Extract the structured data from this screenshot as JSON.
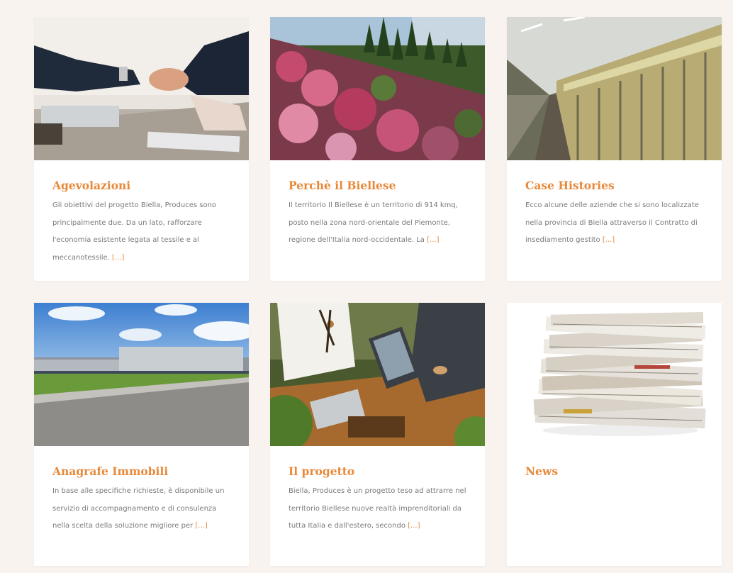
{
  "cards": [
    {
      "title": "Agevolazioni",
      "text": "Gli obiettivi del progetto Biella, Produces sono principalmente due. Da un lato, rafforzare l'economia esistente legata al tessile e al meccanotessile.",
      "more": "[...]",
      "image_icon": "handshake-image"
    },
    {
      "title": "Perchè il Biellese",
      "text": "Il territorio Il Biellese è un territorio di 914 kmq, posto nella zona nord-orientale del Piemonte, regione dell'Italia nord-occidentale. La",
      "more": "[...]",
      "image_icon": "flower-hillside-image"
    },
    {
      "title": "Case Histories",
      "text": "Ecco alcune delle aziende che si sono localizzate nella provincia di Biella attraverso il Contratto di insediamento gestito",
      "more": "[...]",
      "image_icon": "textile-factory-image"
    },
    {
      "title": "Anagrafe Immobili",
      "text": "In base alle specifiche richieste, è disponibile un servizio di accompagnamento e di consulenza nella scelta della soluzione migliore per",
      "more": "[...]",
      "image_icon": "warehouse-building-image"
    },
    {
      "title": "Il progetto",
      "text": "Biella, Produces è un progetto teso ad attrarre nel territorio Biellese nuove realtà imprenditoriali da tutta Italia e dall'estero, secondo",
      "more": "[...]",
      "image_icon": "business-meeting-image"
    },
    {
      "title": "News",
      "text": "",
      "more": "",
      "image_icon": "newspaper-stack-image"
    }
  ],
  "colors": {
    "accent": "#e8893a",
    "text": "#7a7a7a",
    "page_bg": "#f8f3ee",
    "card_bg": "#ffffff"
  }
}
